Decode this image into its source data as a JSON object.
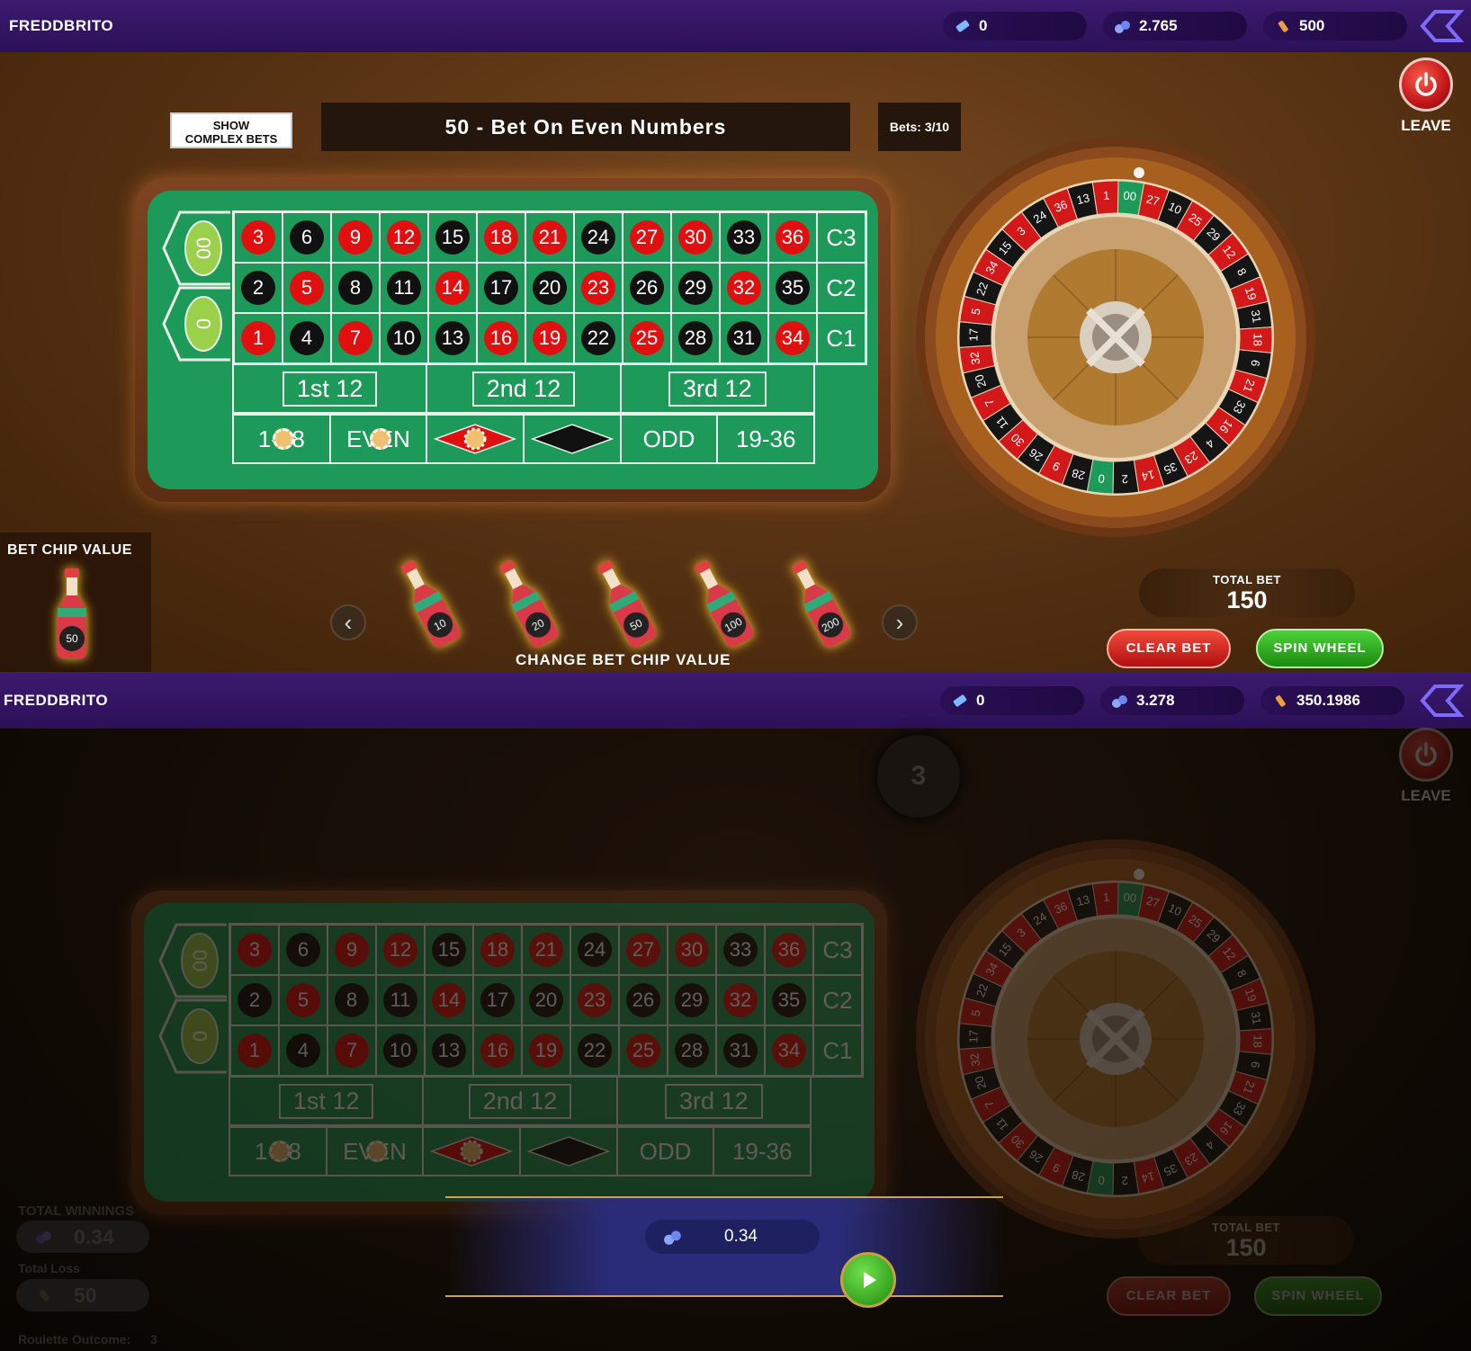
{
  "screen1": {
    "username": "FREDDBRITO",
    "stats": [
      {
        "icon": "ticket-icon",
        "value": "0"
      },
      {
        "icon": "coins-icon",
        "value": "2.765"
      },
      {
        "icon": "bottle-icon",
        "value": "500"
      }
    ],
    "show_complex_bets_label": "SHOW\nCOMPLEX BETS",
    "bet_description": "50 - Bet On Even Numbers",
    "bets_count": "Bets: 3/10",
    "leave_label": "LEAVE",
    "bet_chip_value_label": "BET CHIP VALUE",
    "current_chip": "50",
    "chip_values": [
      "10",
      "20",
      "50",
      "100",
      "200"
    ],
    "change_chip_label": "CHANGE BET CHIP VALUE",
    "total_bet_label": "TOTAL BET",
    "total_bet_value": "150",
    "clear_bet_label": "CLEAR BET",
    "spin_wheel_label": "SPIN WHEEL"
  },
  "screen2": {
    "username": "FREDDBRITO",
    "stats": [
      {
        "icon": "ticket-icon",
        "value": "0"
      },
      {
        "icon": "coins-icon",
        "value": "3.278"
      },
      {
        "icon": "bottle-icon",
        "value": "350.1986"
      }
    ],
    "leave_label": "LEAVE",
    "result_number": "3",
    "total_winnings_label": "TOTAL WINNINGS",
    "total_winnings_value": "0.34",
    "total_loss_label": "Total Loss",
    "total_loss_value": "50",
    "roulette_outcome_label": "Roulette Outcome:",
    "roulette_outcome_value": "3",
    "win_amount": "0.34",
    "total_bet_label": "TOTAL BET",
    "total_bet_value": "150",
    "clear_bet_label": "CLEAR BET",
    "spin_wheel_label": "SPIN WHEEL"
  },
  "table": {
    "zeros": [
      "00",
      "0"
    ],
    "rows": [
      [
        {
          "n": "3",
          "c": "red"
        },
        {
          "n": "6",
          "c": "black"
        },
        {
          "n": "9",
          "c": "red"
        },
        {
          "n": "12",
          "c": "red"
        },
        {
          "n": "15",
          "c": "black"
        },
        {
          "n": "18",
          "c": "red"
        },
        {
          "n": "21",
          "c": "red"
        },
        {
          "n": "24",
          "c": "black"
        },
        {
          "n": "27",
          "c": "red"
        },
        {
          "n": "30",
          "c": "red"
        },
        {
          "n": "33",
          "c": "black"
        },
        {
          "n": "36",
          "c": "red"
        }
      ],
      [
        {
          "n": "2",
          "c": "black"
        },
        {
          "n": "5",
          "c": "red"
        },
        {
          "n": "8",
          "c": "black"
        },
        {
          "n": "11",
          "c": "black"
        },
        {
          "n": "14",
          "c": "red"
        },
        {
          "n": "17",
          "c": "black"
        },
        {
          "n": "20",
          "c": "black"
        },
        {
          "n": "23",
          "c": "red"
        },
        {
          "n": "26",
          "c": "black"
        },
        {
          "n": "29",
          "c": "black"
        },
        {
          "n": "32",
          "c": "red"
        },
        {
          "n": "35",
          "c": "black"
        }
      ],
      [
        {
          "n": "1",
          "c": "red"
        },
        {
          "n": "4",
          "c": "black"
        },
        {
          "n": "7",
          "c": "red"
        },
        {
          "n": "10",
          "c": "black"
        },
        {
          "n": "13",
          "c": "black"
        },
        {
          "n": "16",
          "c": "red"
        },
        {
          "n": "19",
          "c": "red"
        },
        {
          "n": "22",
          "c": "black"
        },
        {
          "n": "25",
          "c": "red"
        },
        {
          "n": "28",
          "c": "black"
        },
        {
          "n": "31",
          "c": "black"
        },
        {
          "n": "34",
          "c": "red"
        }
      ]
    ],
    "columns": [
      "C3",
      "C2",
      "C1"
    ],
    "dozens": [
      "1st 12",
      "2nd 12",
      "3rd 12"
    ],
    "outside": [
      "1-18",
      "EVEN",
      "red-diamond",
      "black-diamond",
      "ODD",
      "19-36"
    ]
  },
  "wheel_numbers": [
    "00",
    "27",
    "10",
    "25",
    "29",
    "12",
    "8",
    "19",
    "31",
    "18",
    "6",
    "21",
    "33",
    "16",
    "4",
    "23",
    "35",
    "14",
    "2",
    "0",
    "28",
    "9",
    "26",
    "30",
    "11",
    "7",
    "20",
    "32",
    "17",
    "5",
    "22",
    "34",
    "15",
    "3",
    "24",
    "36",
    "13",
    "1"
  ],
  "colors": {
    "red": "#e01010",
    "black": "#111111",
    "green": "#1d9a59",
    "topbar": "#3c1a6e"
  }
}
